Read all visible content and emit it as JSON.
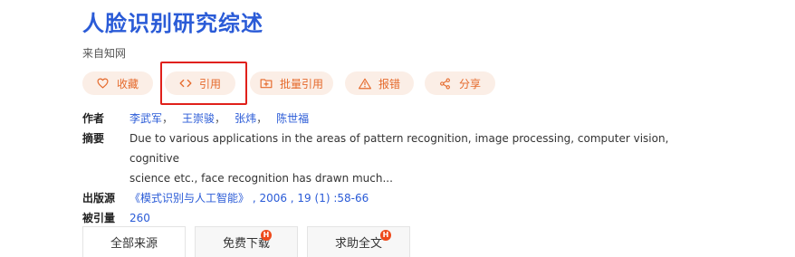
{
  "title": "人脸识别研究综述",
  "source_note": "来自知网",
  "actions": {
    "favorite": "收藏",
    "cite": "引用",
    "batch_cite": "批量引用",
    "report": "报错",
    "share": "分享"
  },
  "meta": {
    "authors_label": "作者",
    "authors": [
      "李武军",
      "王崇骏",
      "张炜",
      "陈世福"
    ],
    "author_separator": "，",
    "abstract_label": "摘要",
    "abstract_line1": "Due to various applications in the areas of pattern recognition, image processing, computer vision, cognitive",
    "abstract_line2": "science etc., face recognition has drawn much...",
    "source_label": "出版源",
    "source_value": "《模式识别与人工智能》 , 2006 , 19 (1) :58-66",
    "cited_label": "被引量",
    "cited_value": "260"
  },
  "tabs": {
    "all_sources": "全部来源",
    "free_download": "免费下载",
    "request_full_text": "求助全文",
    "hot_badge": "H"
  },
  "colors": {
    "title": "#2a5bd7",
    "link": "#2a5bd7",
    "pill_bg": "#fbeee6",
    "pill_text": "#e56a2c",
    "highlight": "#e0201a",
    "hot_badge": "#ee4a1c"
  },
  "icons": {
    "favorite": "heart-icon",
    "cite": "code-brackets-icon",
    "batch_cite": "folder-plus-icon",
    "report": "warning-triangle-icon",
    "share": "share-nodes-icon"
  }
}
